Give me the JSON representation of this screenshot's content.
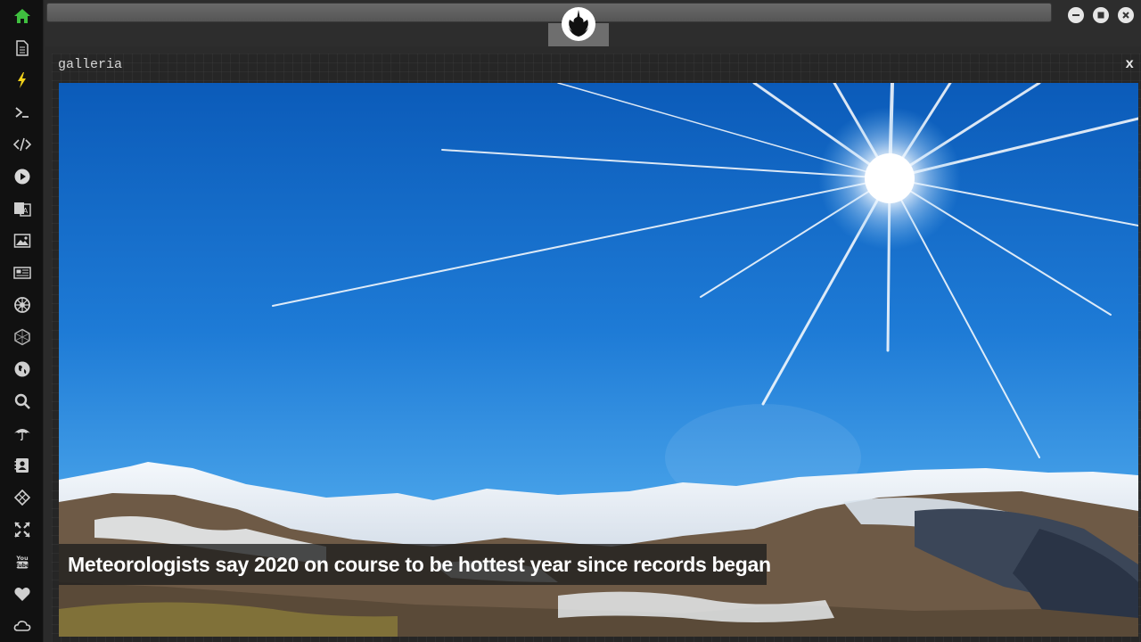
{
  "panel": {
    "title": "galleria",
    "close_label": "x"
  },
  "gallery": {
    "caption": "Meteorologists say 2020 on course to be hottest year since records began"
  },
  "sidebar": {
    "items": [
      {
        "icon": "home-icon",
        "color": "#3fbf3f"
      },
      {
        "icon": "document-icon"
      },
      {
        "icon": "lightning-icon",
        "color": "#f2d21b"
      },
      {
        "icon": "terminal-icon"
      },
      {
        "icon": "code-icon"
      },
      {
        "icon": "play-icon"
      },
      {
        "icon": "translate-icon"
      },
      {
        "icon": "image-icon"
      },
      {
        "icon": "newspaper-icon"
      },
      {
        "icon": "empire-icon"
      },
      {
        "icon": "hexagon-icon"
      },
      {
        "icon": "globe-icon"
      },
      {
        "icon": "search-icon"
      },
      {
        "icon": "umbrella-icon"
      },
      {
        "icon": "contacts-icon"
      },
      {
        "icon": "codepen-icon"
      },
      {
        "icon": "expand-icon"
      },
      {
        "icon": "youtube-icon"
      },
      {
        "icon": "heart-icon"
      },
      {
        "icon": "cloud-icon"
      }
    ]
  },
  "window_controls": [
    "minimize-icon",
    "maximize-icon",
    "close-icon"
  ],
  "colors": {
    "accent_home": "#3fbf3f",
    "accent_bolt": "#f2d21b",
    "sky": "#1e7bd6"
  }
}
